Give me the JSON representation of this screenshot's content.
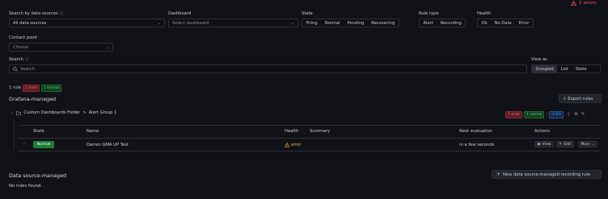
{
  "top": {
    "errors_label": "2 errors",
    "error_color": "#f15c6e"
  },
  "filters": {
    "search_by_ds": {
      "label": "Search by data sources",
      "value": "All data sources"
    },
    "dashboard": {
      "label": "Dashboard",
      "placeholder": "Select dashboard"
    },
    "state": {
      "label": "State",
      "options": [
        "Firing",
        "Normal",
        "Pending",
        "Recovering"
      ]
    },
    "rule_type": {
      "label": "Rule type",
      "options": [
        "Alert",
        "Recording"
      ]
    },
    "health": {
      "label": "Health",
      "options": [
        "Ok",
        "No Data",
        "Error"
      ]
    },
    "contact_point": {
      "label": "Contact point",
      "placeholder": "Choose"
    },
    "search": {
      "label": "Search",
      "placeholder": "Search"
    },
    "view_as": {
      "label": "View as",
      "options": [
        "Grouped",
        "List",
        "State"
      ],
      "active": "Grouped"
    }
  },
  "summary": {
    "rule_count": "1 rule",
    "error_badge": "1 error",
    "normal_badge": "1 normal"
  },
  "grafana_managed": {
    "title": "Grafana-managed",
    "export_label": "Export rules",
    "group": {
      "folder": "Custom Dashboards Folder",
      "separator": ">",
      "name": "Alert Group 1",
      "error_badge": "1 error",
      "normal_badge": "1 normal",
      "interval": "1m"
    },
    "table": {
      "headers": {
        "state": "State",
        "name": "Name",
        "health": "Health",
        "summary": "Summary",
        "next_eval": "Next evaluation",
        "actions": "Actions"
      },
      "row": {
        "state": "Normal",
        "name": "Darren GMA UP Test",
        "health": "error",
        "next_eval": "in a few seconds",
        "view": "View",
        "edit": "Edit",
        "more": "More"
      }
    }
  },
  "datasource_managed": {
    "title": "Data source-managed",
    "new_rule_label": "New data source-managed recording rule",
    "empty": "No rules found."
  },
  "colors": {
    "normal_green": "#1a7f37",
    "warning": "#f5b73d",
    "background": "#111217"
  }
}
